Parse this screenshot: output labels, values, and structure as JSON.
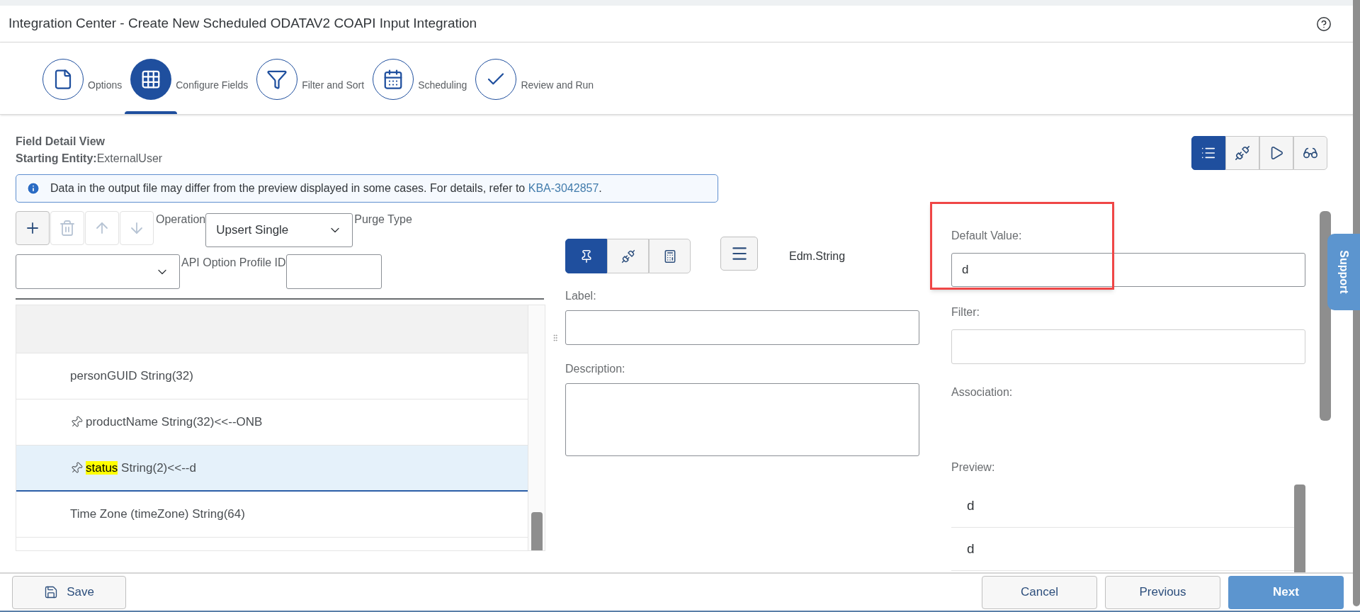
{
  "window": {
    "title": "Integration Center - Create New Scheduled ODATAV2 COAPI Input Integration"
  },
  "steps": [
    {
      "kind": "document",
      "label": "Options",
      "selected": false
    },
    {
      "kind": "grid",
      "label": "Configure Fields",
      "selected": true
    },
    {
      "kind": "filter",
      "label": "Filter and Sort",
      "selected": false
    },
    {
      "kind": "calendar",
      "label": "Scheduling",
      "selected": false
    },
    {
      "kind": "check",
      "label": "Review and Run",
      "selected": false
    }
  ],
  "header": {
    "title": "Field Detail View",
    "entity_label": "Starting Entity:",
    "entity_value": "ExternalUser"
  },
  "view_buttons": [
    {
      "kind": "list",
      "selected": true
    },
    {
      "kind": "unlink",
      "selected": false
    },
    {
      "kind": "play",
      "selected": false
    },
    {
      "kind": "glasses",
      "selected": false
    }
  ],
  "info": {
    "text": "Data in the output file may differ from the preview displayed in some cases. For details, refer to",
    "link": "KBA-3042857",
    "after": "."
  },
  "field_toolbar": [
    {
      "kind": "add",
      "disabled": false
    },
    {
      "kind": "delete",
      "disabled": true
    },
    {
      "kind": "up",
      "disabled": true
    },
    {
      "kind": "down",
      "disabled": true
    }
  ],
  "operation": {
    "label": "Operation",
    "value": "Upsert Single"
  },
  "purge_type": {
    "label": "Purge Type"
  },
  "api_option_profile": {
    "label": "API Option Profile ID"
  },
  "fields": [
    {
      "name": "personGUID",
      "detail": "String(32)",
      "pinned": false,
      "highlighted": false,
      "selected": false
    },
    {
      "name": "productName",
      "detail": "String(32)<<--ONB",
      "pinned": true,
      "highlighted": false,
      "selected": false
    },
    {
      "name": "status",
      "detail": "String(2)<<--d",
      "pinned": true,
      "highlighted": true,
      "selected": true
    },
    {
      "name": "Time Zone (timeZone)",
      "detail": "String(64)",
      "pinned": false,
      "highlighted": false,
      "selected": false
    }
  ],
  "detail": {
    "mode_buttons": [
      {
        "kind": "pin",
        "selected": true
      },
      {
        "kind": "unlink",
        "selected": false
      },
      {
        "kind": "calculator",
        "selected": false
      }
    ],
    "type": "Edm.String",
    "label": {
      "label": "Label:"
    },
    "description": {
      "label": "Description:"
    },
    "default_value": {
      "label": "Default Value:",
      "value": "d"
    },
    "filter": {
      "label": "Filter:"
    },
    "association": {
      "label": "Association:"
    },
    "preview": {
      "label": "Preview:",
      "rows": [
        "d",
        "d"
      ]
    }
  },
  "support_tab": "Support",
  "footer": {
    "save": "Save",
    "cancel": "Cancel",
    "previous": "Previous",
    "next": "Next"
  }
}
